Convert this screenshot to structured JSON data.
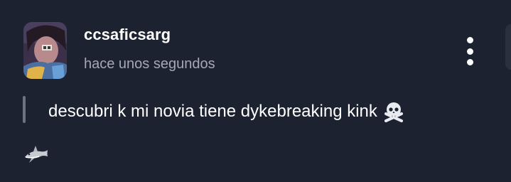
{
  "post": {
    "username": "ccsaficsarg",
    "timestamp": "hace unos segundos",
    "text": "descubri k mi novia tiene dykebreaking kink",
    "text_emoji": "skull-and-crossbones-icon",
    "footer_emoji": "shark-icon"
  },
  "icons": {
    "menu": "more-vertical-icon"
  },
  "colors": {
    "background": "#1c2230",
    "text_primary": "#ffffff",
    "text_secondary": "#a4a9b3",
    "quote_bar": "#6d7380"
  }
}
